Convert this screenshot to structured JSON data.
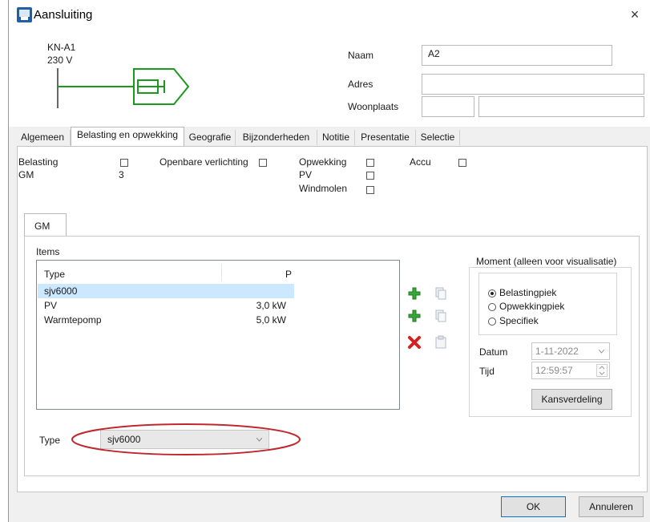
{
  "window": {
    "title": "Aansluiting",
    "close_glyph": "×"
  },
  "diagram": {
    "node_name": "KN-A1",
    "voltage": "230 V",
    "line_color": "#1a9a1a"
  },
  "fields": {
    "naam_label": "Naam",
    "naam_value": "A2",
    "adres_label": "Adres",
    "adres_value": "",
    "woonplaats_label": "Woonplaats",
    "woonplaats_value1": "",
    "woonplaats_value2": ""
  },
  "tabs": [
    {
      "label": "Algemeen",
      "active": false
    },
    {
      "label": "Belasting en opwekking",
      "active": true
    },
    {
      "label": "Geografie",
      "active": false
    },
    {
      "label": "Bijzonderheden",
      "active": false
    },
    {
      "label": "Notitie",
      "active": false
    },
    {
      "label": "Presentatie",
      "active": false
    },
    {
      "label": "Selectie",
      "active": false
    }
  ],
  "belasting": {
    "belasting_label": "Belasting",
    "belasting_checked": false,
    "gm_label": "GM",
    "gm_value": "3",
    "openbare_label": "Openbare verlichting",
    "openbare_checked": false,
    "opwekking_label": "Opwekking",
    "opwekking_checked": false,
    "pv_label": "PV",
    "pv_checked": false,
    "windmolen_label": "Windmolen",
    "windmolen_checked": false,
    "accu_label": "Accu",
    "accu_checked": false
  },
  "gm_tab": {
    "label": "GM"
  },
  "items": {
    "label": "Items",
    "columns": [
      "Type",
      "P"
    ],
    "rows": [
      {
        "type": "sjv6000",
        "p": "",
        "selected": true
      },
      {
        "type": "PV",
        "p": "3,0 kW",
        "selected": false
      },
      {
        "type": "Warmtepomp",
        "p": "5,0 kW",
        "selected": false
      }
    ]
  },
  "toolbar_icons": [
    "add-icon",
    "copy-icon",
    "add-icon",
    "copy-icon",
    "delete-icon",
    "paste-icon"
  ],
  "moment": {
    "title": "Moment (alleen voor visualisatie)",
    "options": [
      {
        "label": "Belastingpiek",
        "selected": true
      },
      {
        "label": "Opwekkingpiek",
        "selected": false
      },
      {
        "label": "Specifiek",
        "selected": false
      }
    ],
    "datum_label": "Datum",
    "datum_value": "1-11-2022",
    "tijd_label": "Tijd",
    "tijd_value": "12:59:57",
    "kans_button": "Kansverdeling"
  },
  "type_select": {
    "label": "Type",
    "value": "sjv6000"
  },
  "highlight_color": "#c0282d",
  "footer": {
    "ok": "OK",
    "cancel": "Annuleren"
  }
}
